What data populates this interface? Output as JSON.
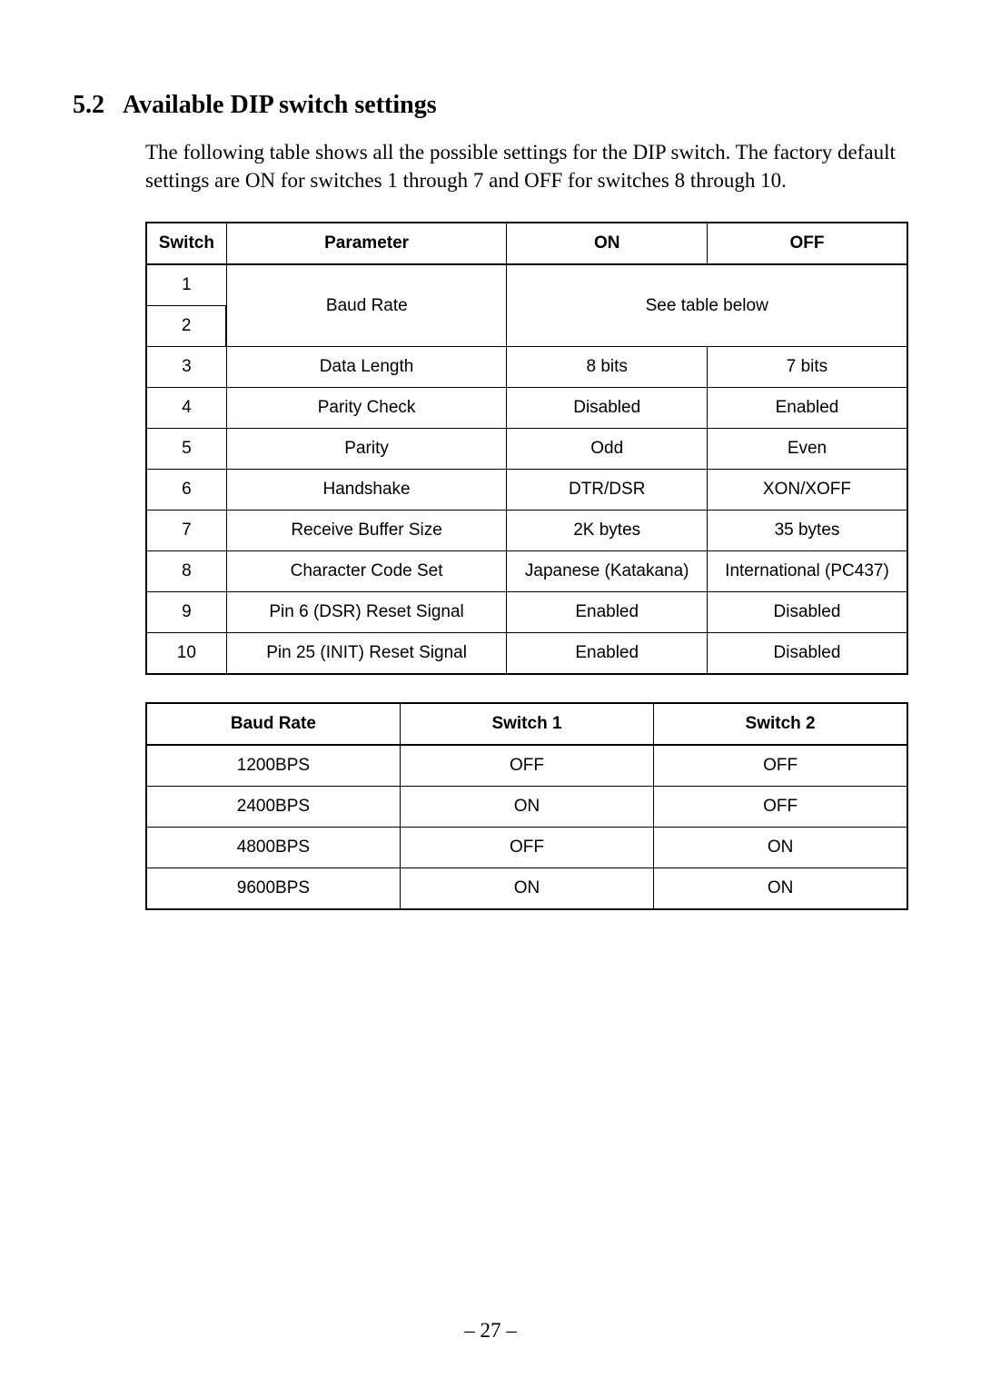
{
  "heading": {
    "number": "5.2",
    "title": "Available DIP switch settings"
  },
  "intro": "The following table shows all the possible settings for the DIP switch. The factory default settings are ON for switches 1 through 7 and OFF for switches 8 through 10.",
  "table1": {
    "headers": {
      "switch": "Switch",
      "parameter": "Parameter",
      "on": "ON",
      "off": "OFF"
    },
    "baudRow": {
      "sw1": "1",
      "sw2": "2",
      "param": "Baud Rate",
      "note": "See table below"
    },
    "rows": [
      {
        "switch": "3",
        "parameter": "Data Length",
        "on": "8 bits",
        "off": "7 bits"
      },
      {
        "switch": "4",
        "parameter": "Parity Check",
        "on": "Disabled",
        "off": "Enabled"
      },
      {
        "switch": "5",
        "parameter": "Parity",
        "on": "Odd",
        "off": "Even"
      },
      {
        "switch": "6",
        "parameter": "Handshake",
        "on": "DTR/DSR",
        "off": "XON/XOFF"
      },
      {
        "switch": "7",
        "parameter": "Receive Buffer Size",
        "on": "2K bytes",
        "off": "35 bytes"
      },
      {
        "switch": "8",
        "parameter": "Character Code Set",
        "on": "Japanese (Katakana)",
        "off": "International (PC437)"
      },
      {
        "switch": "9",
        "parameter": "Pin 6 (DSR) Reset Signal",
        "on": "Enabled",
        "off": "Disabled"
      },
      {
        "switch": "10",
        "parameter": "Pin 25 (INIT) Reset Signal",
        "on": "Enabled",
        "off": "Disabled"
      }
    ]
  },
  "table2": {
    "headers": {
      "baud": "Baud Rate",
      "sw1": "Switch 1",
      "sw2": "Switch 2"
    },
    "rows": [
      {
        "baud": "1200BPS",
        "sw1": "OFF",
        "sw2": "OFF"
      },
      {
        "baud": "2400BPS",
        "sw1": "ON",
        "sw2": "OFF"
      },
      {
        "baud": "4800BPS",
        "sw1": "OFF",
        "sw2": "ON"
      },
      {
        "baud": "9600BPS",
        "sw1": "ON",
        "sw2": "ON"
      }
    ]
  },
  "pageNumber": "– 27 –"
}
